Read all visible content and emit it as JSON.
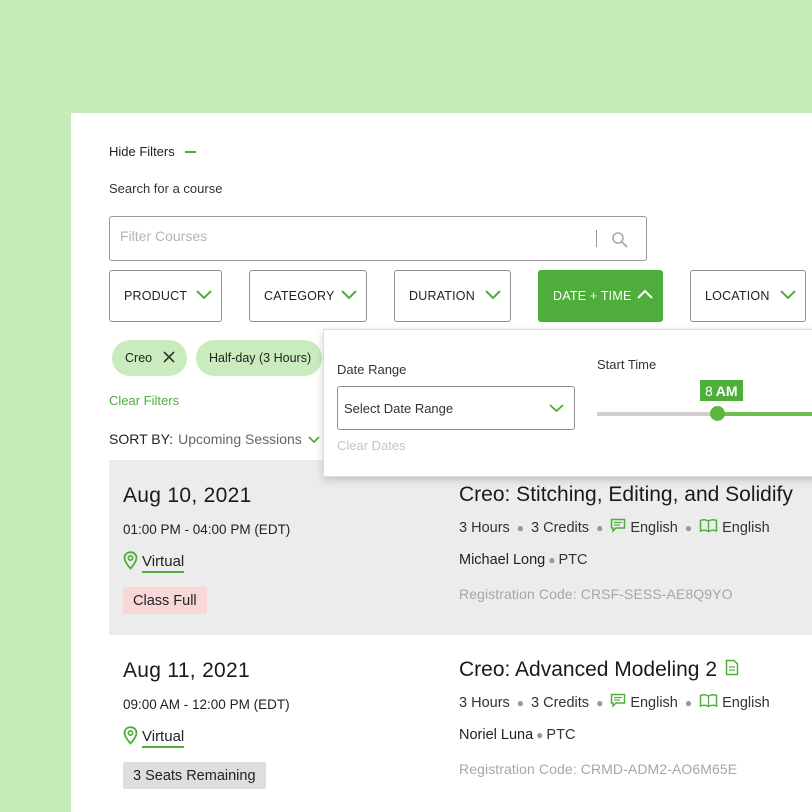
{
  "filters": {
    "hide_filters_label": "Hide Filters",
    "search_label": "Search for a course",
    "search_placeholder": "Filter Courses",
    "buttons": [
      {
        "label": "PRODUCT"
      },
      {
        "label": "CATEGORY"
      },
      {
        "label": "DURATION"
      },
      {
        "label": "DATE + TIME"
      },
      {
        "label": "LOCATION"
      }
    ],
    "chips": [
      {
        "label": "Creo"
      },
      {
        "label": "Half-day (3 Hours)"
      }
    ],
    "clear_filters_label": "Clear Filters",
    "sort_by_label": "SORT BY:",
    "sort_by_value": "Upcoming Sessions"
  },
  "date_time_dropdown": {
    "date_range_label": "Date Range",
    "date_range_placeholder": "Select Date Range",
    "clear_dates_label": "Clear Dates",
    "start_time_label": "Start Time",
    "start_time_value_num": "8",
    "start_time_value_period": "AM"
  },
  "sessions": [
    {
      "date": "Aug 10, 2021",
      "time": "01:00 PM - 04:00 PM (EDT)",
      "location": "Virtual",
      "status": "Class Full",
      "title": "Creo: Stitching, Editing, and Solidify",
      "duration": "3 Hours",
      "credits": "3 Credits",
      "language_spoken": "English",
      "language_materials": "English",
      "instructor": "Michael Long",
      "org": "PTC",
      "registration_code": "Registration Code: CRSF-SESS-AE8Q9YO"
    },
    {
      "date": "Aug 11, 2021",
      "time": "09:00 AM - 12:00 PM (EDT)",
      "location": "Virtual",
      "status": "3 Seats Remaining",
      "title": "Creo: Advanced Modeling 2",
      "duration": "3 Hours",
      "credits": "3 Credits",
      "language_spoken": "English",
      "language_materials": "English",
      "instructor": "Noriel Luna",
      "org": "PTC",
      "registration_code": "Registration Code: CRMD-ADM2-AO6M65E"
    }
  ],
  "colors": {
    "page_background": "#c6ecb9",
    "accent": "#4fae3b",
    "chip_background": "#c9ebbe",
    "class_full_badge": "#f8d7d9",
    "seats_badge": "#dedede",
    "row_gray": "#ececec"
  },
  "icons": {
    "search": "search-icon",
    "chevron": "chevron-down-icon",
    "chevron_up": "chevron-up-icon",
    "remove": "close-icon",
    "location": "map-pin-icon",
    "language": "speech-bubble-icon",
    "materials": "book-icon",
    "document": "document-icon"
  }
}
